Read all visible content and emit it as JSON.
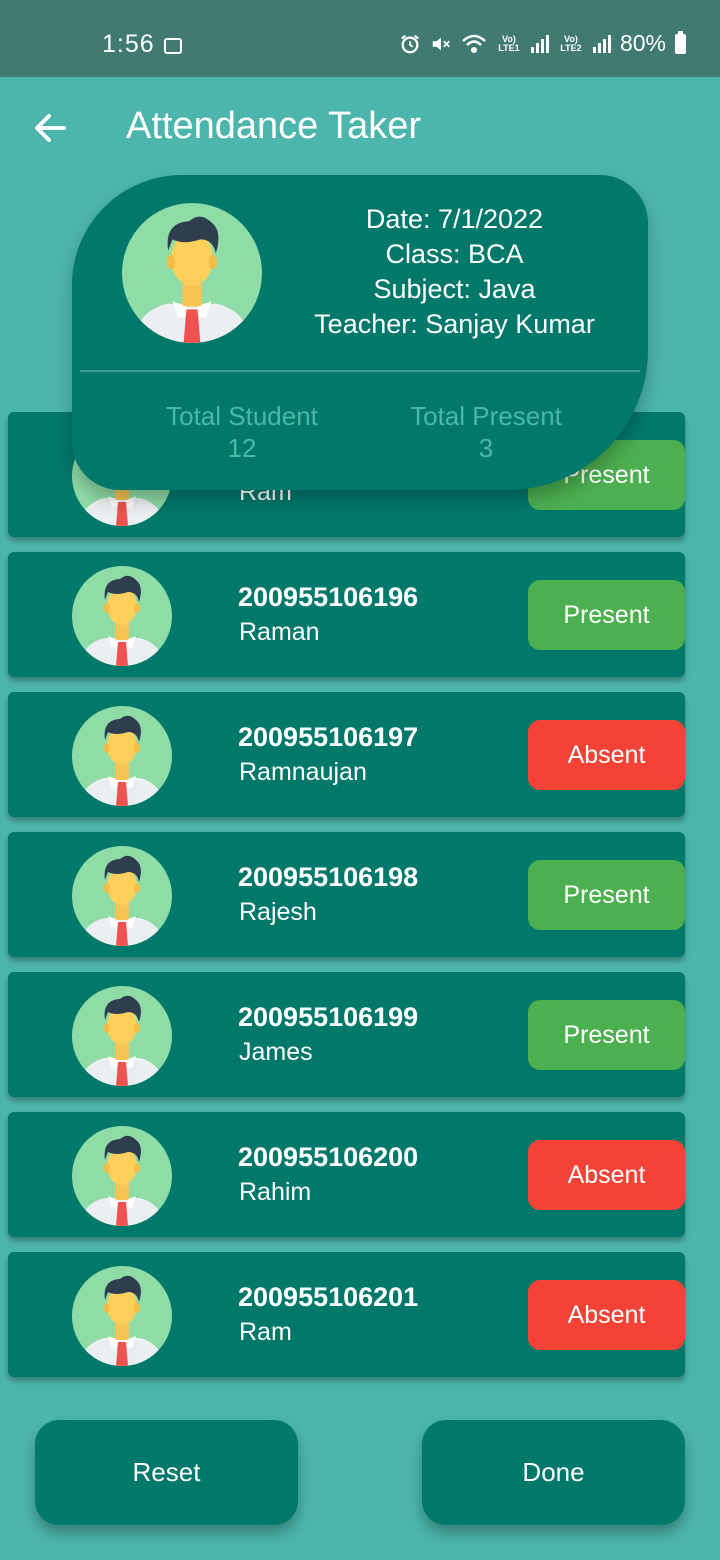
{
  "status_bar": {
    "time": "1:56",
    "lte1": "Vo) LTE1",
    "lte2": "Vo) LTE2",
    "battery": "80%"
  },
  "app": {
    "title": "Attendance Taker"
  },
  "header": {
    "date": "Date: 7/1/2022",
    "class_name": "Class: BCA",
    "subject": "Subject: Java",
    "teacher": "Teacher: Sanjay Kumar",
    "total_student_label": "Total Student",
    "total_student_value": "12",
    "total_present_label": "Total Present",
    "total_present_value": "3"
  },
  "students": [
    {
      "id": "",
      "name": "Ram",
      "status": "Present"
    },
    {
      "id": "200955106196",
      "name": "Raman",
      "status": "Present"
    },
    {
      "id": "200955106197",
      "name": "Ramnaujan",
      "status": "Absent"
    },
    {
      "id": "200955106198",
      "name": "Rajesh",
      "status": "Present"
    },
    {
      "id": "200955106199",
      "name": "James",
      "status": "Present"
    },
    {
      "id": "200955106200",
      "name": "Rahim",
      "status": "Absent"
    },
    {
      "id": "200955106201",
      "name": "Ram",
      "status": "Absent"
    }
  ],
  "buttons": {
    "reset": "Reset",
    "done": "Done"
  },
  "colors": {
    "primary": "#00796b",
    "background": "#4db6ac",
    "present": "#4caf50",
    "absent": "#f44336"
  }
}
